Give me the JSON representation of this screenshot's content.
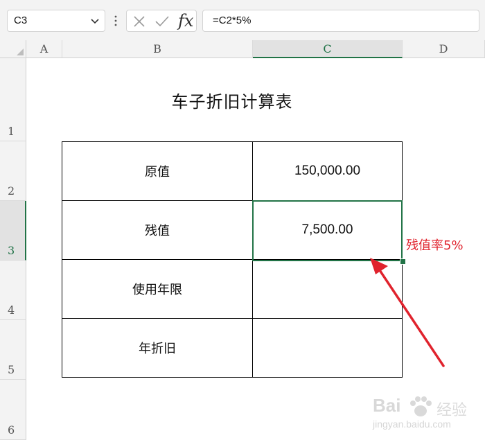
{
  "formula_bar": {
    "name_box": "C3",
    "fx_label": "fx",
    "formula": "=C2*5%"
  },
  "columns": [
    "A",
    "B",
    "C",
    "D"
  ],
  "rows": [
    "1",
    "2",
    "3",
    "4",
    "5",
    "6"
  ],
  "selected_cell": {
    "column": "C",
    "row": "3"
  },
  "sheet": {
    "title": "车子折旧计算表",
    "table": [
      {
        "label": "原值",
        "value": "150,000.00"
      },
      {
        "label": "残值",
        "value": "7,500.00"
      },
      {
        "label": "使用年限",
        "value": ""
      },
      {
        "label": "年折旧",
        "value": ""
      }
    ]
  },
  "annotation": {
    "note": "残值率5%",
    "color": "#e0232d"
  },
  "watermark": {
    "brand": "Bai",
    "suffix": "经验",
    "url": "jingyan.baidu.com"
  },
  "colors": {
    "selection": "#217346",
    "header_bg": "#f3f3f3"
  }
}
